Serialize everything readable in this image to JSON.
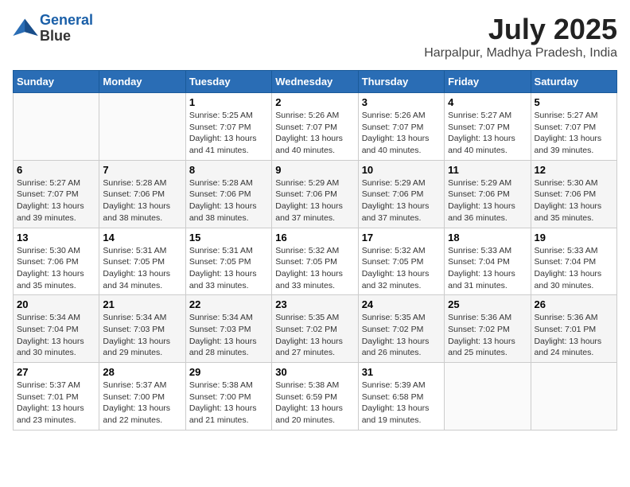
{
  "header": {
    "logo_line1": "General",
    "logo_line2": "Blue",
    "month": "July 2025",
    "location": "Harpalpur, Madhya Pradesh, India"
  },
  "weekdays": [
    "Sunday",
    "Monday",
    "Tuesday",
    "Wednesday",
    "Thursday",
    "Friday",
    "Saturday"
  ],
  "weeks": [
    [
      {
        "day": "",
        "info": ""
      },
      {
        "day": "",
        "info": ""
      },
      {
        "day": "1",
        "info": "Sunrise: 5:25 AM\nSunset: 7:07 PM\nDaylight: 13 hours and 41 minutes."
      },
      {
        "day": "2",
        "info": "Sunrise: 5:26 AM\nSunset: 7:07 PM\nDaylight: 13 hours and 40 minutes."
      },
      {
        "day": "3",
        "info": "Sunrise: 5:26 AM\nSunset: 7:07 PM\nDaylight: 13 hours and 40 minutes."
      },
      {
        "day": "4",
        "info": "Sunrise: 5:27 AM\nSunset: 7:07 PM\nDaylight: 13 hours and 40 minutes."
      },
      {
        "day": "5",
        "info": "Sunrise: 5:27 AM\nSunset: 7:07 PM\nDaylight: 13 hours and 39 minutes."
      }
    ],
    [
      {
        "day": "6",
        "info": "Sunrise: 5:27 AM\nSunset: 7:07 PM\nDaylight: 13 hours and 39 minutes."
      },
      {
        "day": "7",
        "info": "Sunrise: 5:28 AM\nSunset: 7:06 PM\nDaylight: 13 hours and 38 minutes."
      },
      {
        "day": "8",
        "info": "Sunrise: 5:28 AM\nSunset: 7:06 PM\nDaylight: 13 hours and 38 minutes."
      },
      {
        "day": "9",
        "info": "Sunrise: 5:29 AM\nSunset: 7:06 PM\nDaylight: 13 hours and 37 minutes."
      },
      {
        "day": "10",
        "info": "Sunrise: 5:29 AM\nSunset: 7:06 PM\nDaylight: 13 hours and 37 minutes."
      },
      {
        "day": "11",
        "info": "Sunrise: 5:29 AM\nSunset: 7:06 PM\nDaylight: 13 hours and 36 minutes."
      },
      {
        "day": "12",
        "info": "Sunrise: 5:30 AM\nSunset: 7:06 PM\nDaylight: 13 hours and 35 minutes."
      }
    ],
    [
      {
        "day": "13",
        "info": "Sunrise: 5:30 AM\nSunset: 7:06 PM\nDaylight: 13 hours and 35 minutes."
      },
      {
        "day": "14",
        "info": "Sunrise: 5:31 AM\nSunset: 7:05 PM\nDaylight: 13 hours and 34 minutes."
      },
      {
        "day": "15",
        "info": "Sunrise: 5:31 AM\nSunset: 7:05 PM\nDaylight: 13 hours and 33 minutes."
      },
      {
        "day": "16",
        "info": "Sunrise: 5:32 AM\nSunset: 7:05 PM\nDaylight: 13 hours and 33 minutes."
      },
      {
        "day": "17",
        "info": "Sunrise: 5:32 AM\nSunset: 7:05 PM\nDaylight: 13 hours and 32 minutes."
      },
      {
        "day": "18",
        "info": "Sunrise: 5:33 AM\nSunset: 7:04 PM\nDaylight: 13 hours and 31 minutes."
      },
      {
        "day": "19",
        "info": "Sunrise: 5:33 AM\nSunset: 7:04 PM\nDaylight: 13 hours and 30 minutes."
      }
    ],
    [
      {
        "day": "20",
        "info": "Sunrise: 5:34 AM\nSunset: 7:04 PM\nDaylight: 13 hours and 30 minutes."
      },
      {
        "day": "21",
        "info": "Sunrise: 5:34 AM\nSunset: 7:03 PM\nDaylight: 13 hours and 29 minutes."
      },
      {
        "day": "22",
        "info": "Sunrise: 5:34 AM\nSunset: 7:03 PM\nDaylight: 13 hours and 28 minutes."
      },
      {
        "day": "23",
        "info": "Sunrise: 5:35 AM\nSunset: 7:02 PM\nDaylight: 13 hours and 27 minutes."
      },
      {
        "day": "24",
        "info": "Sunrise: 5:35 AM\nSunset: 7:02 PM\nDaylight: 13 hours and 26 minutes."
      },
      {
        "day": "25",
        "info": "Sunrise: 5:36 AM\nSunset: 7:02 PM\nDaylight: 13 hours and 25 minutes."
      },
      {
        "day": "26",
        "info": "Sunrise: 5:36 AM\nSunset: 7:01 PM\nDaylight: 13 hours and 24 minutes."
      }
    ],
    [
      {
        "day": "27",
        "info": "Sunrise: 5:37 AM\nSunset: 7:01 PM\nDaylight: 13 hours and 23 minutes."
      },
      {
        "day": "28",
        "info": "Sunrise: 5:37 AM\nSunset: 7:00 PM\nDaylight: 13 hours and 22 minutes."
      },
      {
        "day": "29",
        "info": "Sunrise: 5:38 AM\nSunset: 7:00 PM\nDaylight: 13 hours and 21 minutes."
      },
      {
        "day": "30",
        "info": "Sunrise: 5:38 AM\nSunset: 6:59 PM\nDaylight: 13 hours and 20 minutes."
      },
      {
        "day": "31",
        "info": "Sunrise: 5:39 AM\nSunset: 6:58 PM\nDaylight: 13 hours and 19 minutes."
      },
      {
        "day": "",
        "info": ""
      },
      {
        "day": "",
        "info": ""
      }
    ]
  ]
}
